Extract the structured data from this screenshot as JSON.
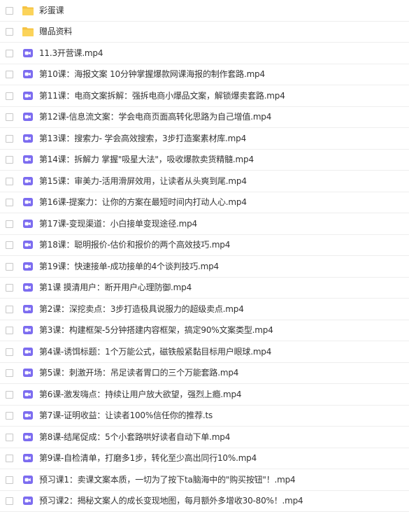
{
  "files": [
    {
      "name": "彩蛋课",
      "type": "folder"
    },
    {
      "name": "赠品资料",
      "type": "folder"
    },
    {
      "name": "11.3开营课.mp4",
      "type": "video"
    },
    {
      "name": "第10课：海报文案 10分钟掌握爆款网课海报的制作套路.mp4",
      "type": "video"
    },
    {
      "name": "第11课：电商文案拆解：强拆电商小爆品文案，解锁爆卖套路.mp4",
      "type": "video"
    },
    {
      "name": "第12课-信息流文案：学会电商页面高转化思路为自己增值.mp4",
      "type": "video"
    },
    {
      "name": "第13课：搜索力- 学会高效搜索，3步打造案素材库.mp4",
      "type": "video"
    },
    {
      "name": "第14课：拆解力 掌握\"吸星大法\"，吸收爆款卖货精髓.mp4",
      "type": "video"
    },
    {
      "name": "第15课：审美力-活用滑屏效用，让读者从头爽到尾.mp4",
      "type": "video"
    },
    {
      "name": "第16课-提案力：让你的方案在最短时间内打动人心.mp4",
      "type": "video"
    },
    {
      "name": "第17课-变现渠道：小白接单变现途径.mp4",
      "type": "video"
    },
    {
      "name": "第18课：聪明报价-估价和报价的两个高效技巧.mp4",
      "type": "video"
    },
    {
      "name": "第19课：快速接单-成功接单的4个谈判技巧.mp4",
      "type": "video"
    },
    {
      "name": "第1课 摸清用户：断开用户心理防御.mp4",
      "type": "video"
    },
    {
      "name": "第2课：深挖卖点：3步打造极具说服力的超级卖点.mp4",
      "type": "video"
    },
    {
      "name": "第3课：构建框架-5分钟搭建内容框架，搞定90%文案类型.mp4",
      "type": "video"
    },
    {
      "name": "第4课-诱饵标题：1个万能公式，磁铁般紧黏目标用户眼球.mp4",
      "type": "video"
    },
    {
      "name": "第5课：刺激开场：吊足读者胃口的三个万能套路.mp4",
      "type": "video"
    },
    {
      "name": "第6课-激发嗨点：持续让用户放大欲望，强烈上瘾.mp4",
      "type": "video"
    },
    {
      "name": "第7课-证明收益：让读者100%信任你的推荐.ts",
      "type": "video"
    },
    {
      "name": "第8课-结尾促成：5个小套路哄好读者自动下单.mp4",
      "type": "video"
    },
    {
      "name": "第9课-自检清单，打磨多1步，转化至少高出同行10%.mp4",
      "type": "video"
    },
    {
      "name": "预习课1：卖课文案本质，一切为了按下ta脑海中的\"购买按钮\"！.mp4",
      "type": "video"
    },
    {
      "name": "预习课2：揭秘文案人的成长变现地图，每月额外多增收30-80%！.mp4",
      "type": "video"
    }
  ]
}
